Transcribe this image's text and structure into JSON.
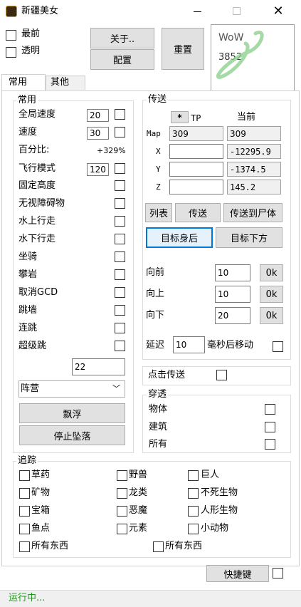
{
  "window": {
    "title": "新疆美女"
  },
  "top": {
    "topmost_label": "最前",
    "transparent_label": "透明",
    "about_label": "关于..",
    "config_label": "配置",
    "reset_label": "重置",
    "wow_label": "WoW",
    "wow_pid": "3852"
  },
  "tabs": [
    {
      "label": "常用"
    },
    {
      "label": "其他"
    }
  ],
  "common": {
    "title": "常用",
    "global_speed_label": "全局速度",
    "global_speed_value": "20",
    "speed_label": "速度",
    "speed_value": "30",
    "percent_label": "百分比:",
    "percent_value": "+329%",
    "fly_label": "飞行模式",
    "fly_value": "120",
    "items": [
      "固定高度",
      "无视障碍物",
      "水上行走",
      "水下行走",
      "坐骑",
      "攀岩",
      "取消GCD",
      "跳墙",
      "连跳",
      "超级跳"
    ],
    "super_jump_value": "22",
    "faction_label": "阵营",
    "float_label": "飘浮",
    "stop_fall_label": "停止坠落"
  },
  "teleport": {
    "title": "传送",
    "star_label": "*",
    "tp_label": "TP",
    "current_label": "当前",
    "rows": [
      {
        "label": "Map",
        "tp": "309",
        "current": "309"
      },
      {
        "label": "X",
        "tp": "",
        "current": "-12295.9"
      },
      {
        "label": "Y",
        "tp": "",
        "current": "-1374.5"
      },
      {
        "label": "Z",
        "tp": "",
        "current": "145.2"
      }
    ],
    "list_label": "列表",
    "go_label": "传送",
    "to_corpse_label": "传送到尸体",
    "target_behind_label": "目标身后",
    "target_below_label": "目标下方",
    "forward_label": "向前",
    "forward_value": "10",
    "up_label": "向上",
    "up_value": "10",
    "down_label": "向下",
    "down_value": "20",
    "ok_label": "0k",
    "delay_label": "延迟",
    "delay_value": "10",
    "delay_suffix": "毫秒后移动"
  },
  "click_tp": {
    "label": "点击传送"
  },
  "penetrate": {
    "title": "穿透",
    "items": [
      "物体",
      "建筑",
      "所有"
    ]
  },
  "track": {
    "title": "追踪",
    "col1": [
      "草药",
      "矿物",
      "宝箱",
      "鱼点"
    ],
    "col2": [
      "野兽",
      "龙类",
      "恶魔",
      "元素"
    ],
    "col3": [
      "巨人",
      "不死生物",
      "人形生物",
      "小动物"
    ],
    "all_left": "所有东西",
    "all_right": "所有东西"
  },
  "hotkey_label": "快捷键",
  "status": {
    "text": "运行中..."
  }
}
